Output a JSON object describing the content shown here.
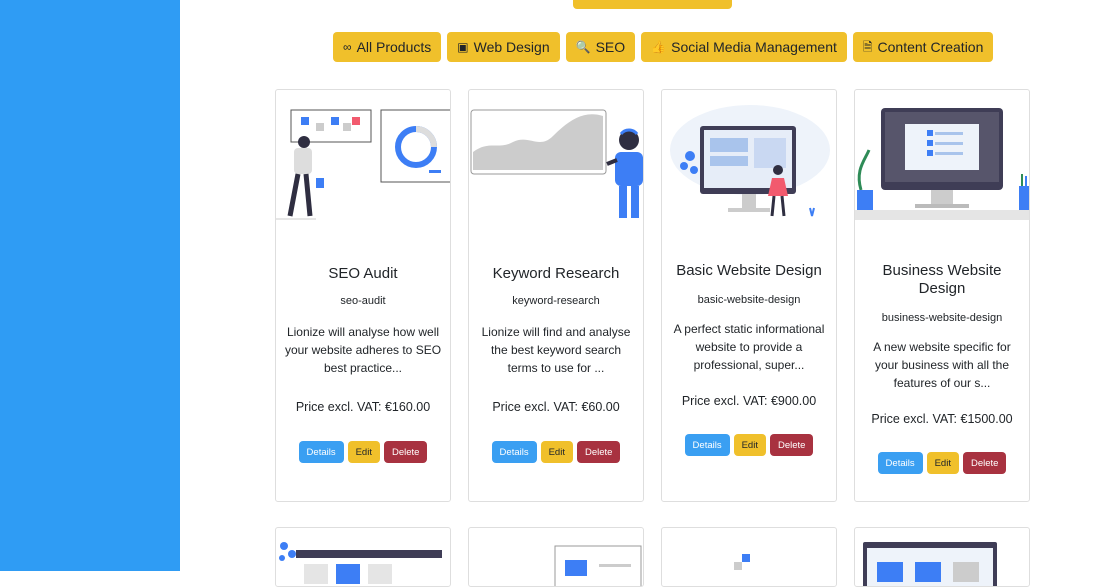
{
  "filters": [
    {
      "icon": "infinity-icon",
      "glyph": "∞",
      "label": "All Products"
    },
    {
      "icon": "image-icon",
      "glyph": "▣",
      "label": "Web Design"
    },
    {
      "icon": "search-icon",
      "glyph": "🔍",
      "label": "SEO"
    },
    {
      "icon": "thumbs-up-icon",
      "glyph": "👍",
      "label": "Social Media Management"
    },
    {
      "icon": "file-icon",
      "glyph": "🗎",
      "label": "Content Creation"
    }
  ],
  "products": [
    {
      "title": "SEO Audit",
      "slug": "seo-audit",
      "description": "Lionize will analyse how well your website adheres to SEO best practice...",
      "price": "Price excl. VAT: €160.00"
    },
    {
      "title": "Keyword Research",
      "slug": "keyword-research",
      "description": "Lionize will find and analyse the best keyword search terms to use for ...",
      "price": "Price excl. VAT: €60.00"
    },
    {
      "title": "Basic Website Design",
      "slug": "basic-website-design",
      "description": "A perfect static informational website to provide a professional, super...",
      "price": "Price excl. VAT: €900.00"
    },
    {
      "title": "Business Website Design",
      "slug": "business-website-design",
      "description": "A new website specific for your business with all the features of our s...",
      "price": "Price excl. VAT: €1500.00"
    }
  ],
  "actions": {
    "details": "Details",
    "edit": "Edit",
    "delete": "Delete"
  },
  "colors": {
    "sidebar": "#2f9cf4",
    "accent": "#f0c02b",
    "details": "#3a9ff2",
    "delete": "#a83240"
  }
}
